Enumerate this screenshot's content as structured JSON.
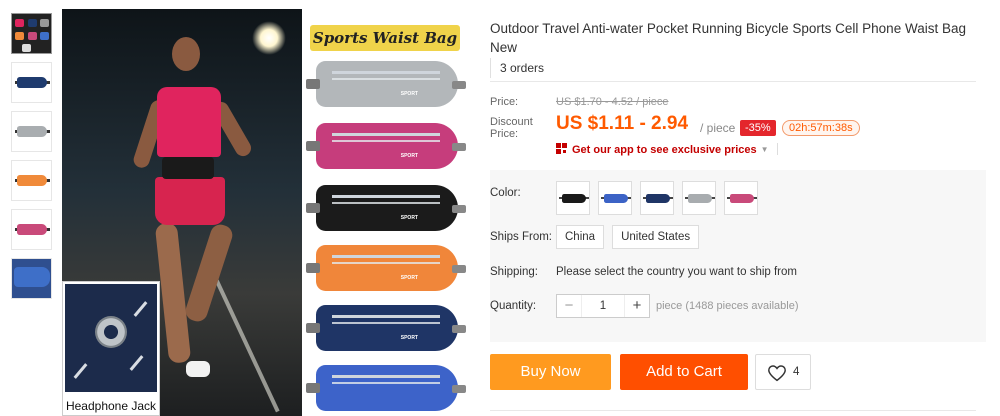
{
  "thumbnails": [
    {
      "label": "collage",
      "colors": [
        "#e0245e",
        "#1f3b6e",
        "#999999",
        "#f08a3a"
      ]
    },
    {
      "label": "navy",
      "color": "#1f3b6e"
    },
    {
      "label": "gray",
      "color": "#a9adb0"
    },
    {
      "label": "orange",
      "color": "#f08a3a"
    },
    {
      "label": "rose",
      "color": "#c94a7a"
    },
    {
      "label": "blue-detail",
      "color": "#3e6fc8"
    }
  ],
  "gallery": {
    "panel_title": "Sports Waist Bag",
    "inset_label": "Headphone Jack",
    "bag_label": "SPORT",
    "bag_colors": [
      "#b3b7ba",
      "#c63d7c",
      "#1b1b1b",
      "#f0863a",
      "#1f3566",
      "#3d63c9"
    ]
  },
  "product": {
    "title": "Outdoor Travel Anti-water Pocket Running Bicycle Sports Cell Phone Waist Bag New",
    "orders": "3 orders"
  },
  "price": {
    "label": "Price:",
    "original": "US $1.70 - 4.52 / piece",
    "discount_label": "Discount Price:",
    "current": "US $1.11 - 2.94",
    "unit": "/ piece",
    "percent_off": "-35%",
    "countdown": "02h:57m:38s",
    "app_link": "Get our app to see exclusive prices",
    "accent_color": "#ff5a00"
  },
  "options": {
    "color_label": "Color:",
    "colors": [
      {
        "name": "black",
        "hex": "#1a1a1a"
      },
      {
        "name": "blue",
        "hex": "#3c63c6"
      },
      {
        "name": "navy",
        "hex": "#1f3566"
      },
      {
        "name": "gray",
        "hex": "#a8acaf"
      },
      {
        "name": "rose",
        "hex": "#c94a7a"
      }
    ],
    "ships_from_label": "Ships From:",
    "ships_from": [
      "China",
      "United States"
    ],
    "shipping_label": "Shipping:",
    "shipping_text": "Please select the country you want to ship from",
    "quantity_label": "Quantity:",
    "quantity_value": "1",
    "minus": "−",
    "plus": "+",
    "availability": "piece (1488 pieces available)"
  },
  "actions": {
    "buy_now": "Buy Now",
    "add_to_cart": "Add to Cart",
    "wishlist_count": "4",
    "buy_color": "#ff9a1f",
    "cart_color": "#ff4f00"
  }
}
